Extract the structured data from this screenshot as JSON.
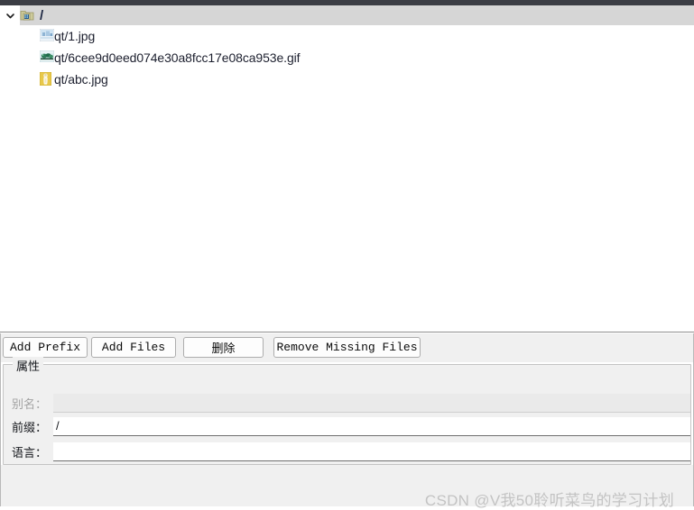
{
  "window": {
    "titlebar_color": "#3b3d44",
    "panel_color": "#f0f0f0"
  },
  "tree": {
    "expand_icon": "chevron-down-icon",
    "root": {
      "icon": "resource-folder-icon",
      "label": "/",
      "selected": true
    },
    "files": [
      {
        "icon": "jpg-image-thumbnail-icon",
        "label": "qt/1.jpg"
      },
      {
        "icon": "gif-image-thumbnail-icon",
        "label": "qt/6cee9d0eed074e30a8fcc17e08ca953e.gif"
      },
      {
        "icon": "jpg-image-thumbnail-icon",
        "label": "qt/abc.jpg"
      }
    ]
  },
  "toolbar": {
    "add_prefix_label": "Add Prefix",
    "add_files_label": "Add Files",
    "delete_label": "删除",
    "remove_missing_label": "Remove Missing Files"
  },
  "properties": {
    "title": "属性",
    "fields": [
      {
        "label": "别名：",
        "value": "",
        "placeholder": "",
        "disabled": true
      },
      {
        "label": "前缀：",
        "value": "/",
        "placeholder": "",
        "disabled": false
      },
      {
        "label": "语言：",
        "value": "",
        "placeholder": "",
        "disabled": false
      }
    ]
  },
  "watermark": {
    "text": "CSDN @V我50聆听菜鸟的学习计划",
    "color": "#c3c3c3"
  }
}
